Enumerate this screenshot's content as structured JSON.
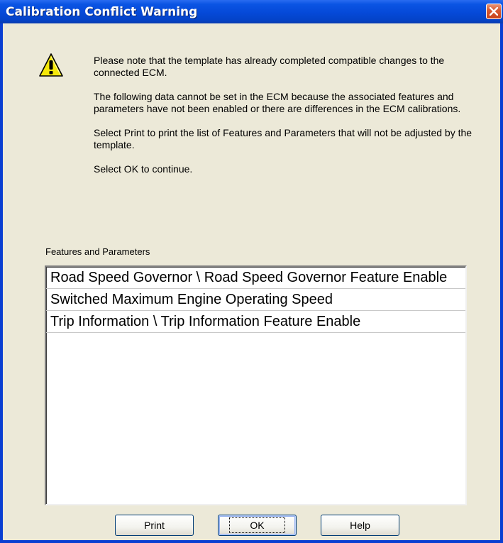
{
  "window": {
    "title": "Calibration Conflict Warning",
    "close_icon": "close-icon"
  },
  "icon": "warning-icon",
  "message": {
    "p1": "Please note that the template has already completed compatible changes to the connected ECM.",
    "p2": "The following data cannot be set in the ECM because the associated features and parameters have not been enabled or there are differences in the ECM calibrations.",
    "p3": "Select Print to print the list of Features and Parameters that will not be adjusted by the template.",
    "p4": "Select OK to continue."
  },
  "list": {
    "label": "Features and Parameters",
    "items": [
      "Road Speed Governor \\  Road Speed Governor Feature Enable",
      "Switched Maximum Engine Operating Speed",
      "Trip Information \\  Trip Information Feature Enable"
    ]
  },
  "buttons": {
    "print": "Print",
    "ok": "OK",
    "help": "Help"
  },
  "colors": {
    "titlebar": "#0549d8",
    "client_bg": "#ece9d8",
    "close_button": "#c9431c",
    "warning_yellow": "#f5e80a"
  }
}
